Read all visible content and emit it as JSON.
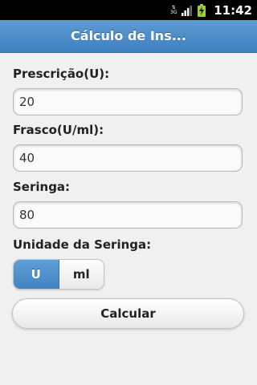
{
  "status_bar": {
    "network_type": "3G",
    "time": "11:42"
  },
  "header": {
    "title": "Cálculo de Ins..."
  },
  "form": {
    "prescricao_label": "Prescrição(U):",
    "prescricao_value": "20",
    "frasco_label": "Frasco(U/ml):",
    "frasco_value": "40",
    "seringa_label": "Seringa:",
    "seringa_value": "80",
    "unidade_label": "Unidade da Seringa:",
    "unit_options": [
      "U",
      "ml"
    ],
    "selected_unit": "U",
    "calcular_label": "Calcular"
  },
  "colors": {
    "header_blue": "#4a8ac8",
    "selected_segment": "#4a8ac8",
    "background": "#f0f0f0"
  }
}
